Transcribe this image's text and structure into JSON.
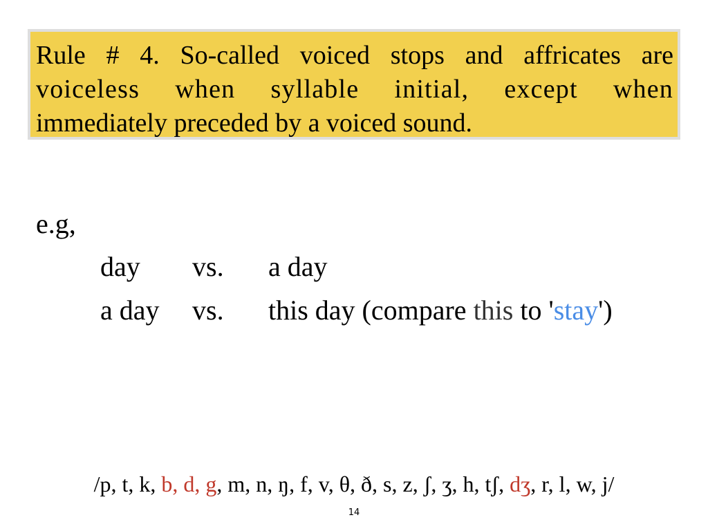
{
  "rule": {
    "line1": "Rule # 4. So-called voiced stops and affricates are",
    "line2": "voiceless when syllable initial, except when",
    "line3": "immediately preceded by a voiced sound.",
    "box_color": "#f2d04e"
  },
  "example": {
    "label": "e.g,",
    "row1": {
      "a": "day",
      "vs": "vs.",
      "b": "a day"
    },
    "row2": {
      "a": "a day",
      "vs": "vs.",
      "b": "this day",
      "compare_open": "(compare ",
      "compare_this": "this",
      "compare_to": " to '",
      "compare_stay": "stay",
      "compare_close": "')"
    }
  },
  "phonemes": {
    "open": "/p, t, k, ",
    "red1": "b, d, g",
    "mid": ", m, n, ŋ, f, v, θ, ð, s, z, ʃ, ʒ, h, tʃ, ",
    "red2": "dʒ",
    "close": ", r, l, w, j/",
    "highlight_color": "#c0392b"
  },
  "page_number": "14",
  "colors": {
    "stay_color": "#4a8de6"
  }
}
